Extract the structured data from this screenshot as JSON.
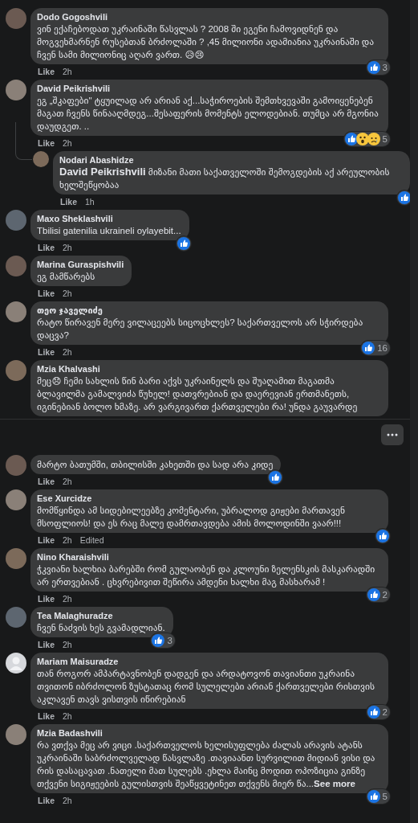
{
  "sections": [
    {
      "comments": [
        {
          "author": "Dodo Gogoshvili",
          "text": "ვინ ექაჩებოდათ უკრაინაში წასვლას ? 2008 ში ეგენი ჩამოვიდნენ და მოგვეხმარნენ რუსებთან ბრძოლაში ? ,45 მილიონი ადამიანია უკრაინაში და ჩვენ სამი მილიონიც აღარ ვართ. 😥😢",
          "like": "Like",
          "time": "2h",
          "reactions": [
            {
              "kind": "like"
            }
          ],
          "reaction_count": "3"
        },
        {
          "author": "David Peikrishvili",
          "text": "ეგ „შკაფები\" ტყუილად არ არიან აქ...საჭიროების შემთხვევაში გამოიყენებენ მაგათ ჩვენს წინააღმდეგ...შესაფერის მომენტს ელოდებიან. თუმცა არ მგონია დაუდგეთ. ..",
          "like": "Like",
          "time": "2h",
          "reactions": [
            {
              "kind": "like"
            },
            {
              "kind": "wow"
            },
            {
              "kind": "sad"
            }
          ],
          "reaction_count": "5",
          "replies": [
            {
              "author": "Nodari Abashidze",
              "text": "**David Peikrishvili** მიზანი მათი საქათველოში შემოგდების აქ არეულობის ხელშეწყობაა",
              "like": "Like",
              "time": "1h",
              "reactions": [
                {
                  "kind": "like"
                }
              ]
            }
          ]
        },
        {
          "author": "Maxo Sheklashvili",
          "text": "Tbilisi gatenilia ukraineli oylayebit...",
          "like": "Like",
          "time": "2h",
          "reactions": [
            {
              "kind": "like"
            }
          ]
        },
        {
          "author": "Marina Guraspishvili",
          "text": "ეგ მამწარებს",
          "like": "Like",
          "time": "2h"
        },
        {
          "author": "თეო ჯაველიძე",
          "text": "რატო წირავენ მერე ვილაცეებს სიცოცხლეს? საქართველოს არ სჭირდება დაცვა?",
          "like": "Like",
          "time": "2h",
          "reactions": [
            {
              "kind": "like"
            }
          ],
          "reaction_count": "16"
        },
        {
          "author": "Mzia Khalvashi",
          "text": "მეც😞 ჩემი სახლის წინ ბარი აქვს უკრაინელს და შუაღამით მაგათმა ბლავილმა გამალვიძა წუხელ! დათვრებიან და დაერევიან ერთმანეთს, იგინებიან ბოლო ხმაზე. არ ვარგივართ ქართველები რა! უნდა გაუვარდე"
        }
      ]
    },
    {
      "comments": [
        {
          "text": "მარტო ბათუმში, თბილისში კახეთში და სად არა კიდე",
          "like": "Like",
          "time": "2h",
          "reactions": [
            {
              "kind": "like"
            }
          ]
        },
        {
          "author": "Ese Xurcidze",
          "text": "მომწყინდა ამ სიდებილეებზე კომენტარი, უბრალოდ გიჟები მართავენ მსოფლიოს! და ეს რაც მალე დამრთავდება ამის მოლოდინში ვაარ!!!",
          "like": "Like",
          "time": "2h",
          "edited": "Edited",
          "reactions": [
            {
              "kind": "like"
            }
          ]
        },
        {
          "author": "Nino Kharaishvili",
          "text": "ჭკვიანი ხალხია ბარებში რომ გულაობენ და კლოუნი ზელენსკის მასკარადში არ ერთვებიან . ცხვრებივით შეწირა ამდენი ხალხი მაგ მასხარამ !",
          "like": "Like",
          "time": "2h",
          "reactions": [
            {
              "kind": "like"
            }
          ],
          "reaction_count": "2"
        },
        {
          "author": "Tea Malaghuradze",
          "text": "ჩვენ ნაძვის ხეს გვამადლიან.",
          "like": "Like",
          "time": "2h",
          "reactions": [
            {
              "kind": "like"
            }
          ],
          "reaction_count": "3"
        },
        {
          "author": "Mariam Maisuradze",
          "default_avatar": true,
          "text": "თან როგორ ამპარტავნობენ დადგენ და არდატოვონ თავიანთი უკრაინა თვითონ იბრძოლონ ზუსტათაც რომ სულელები არიან ქართველები რისთვის აკლავენ თავს ვისთვის იწირებიან",
          "like": "Like",
          "time": "2h",
          "reactions": [
            {
              "kind": "like"
            }
          ],
          "reaction_count": "2"
        },
        {
          "author": "Mzia Badashvili",
          "text": "რა ვთქვა მეც არ ვიცი .საქართველოს ხელისუფლება ძალას არავის ატანს უკრაინაში საბრძოლველად წასვლაზე .თავიაანთ სურვილით მიდიან ვისი და რის დასაცავათ .ნათელი მათ სულებს .ეხლა მაინც მოდით ოპოზიცია გინზე თქვენი სიგიჟეების გულისთვის შეაწყვეტინეთ თქვენს მიერ წა...",
          "see_more": "See more",
          "like": "Like",
          "time": "2h",
          "reactions": [
            {
              "kind": "like"
            }
          ],
          "reaction_count": "5"
        }
      ]
    }
  ]
}
